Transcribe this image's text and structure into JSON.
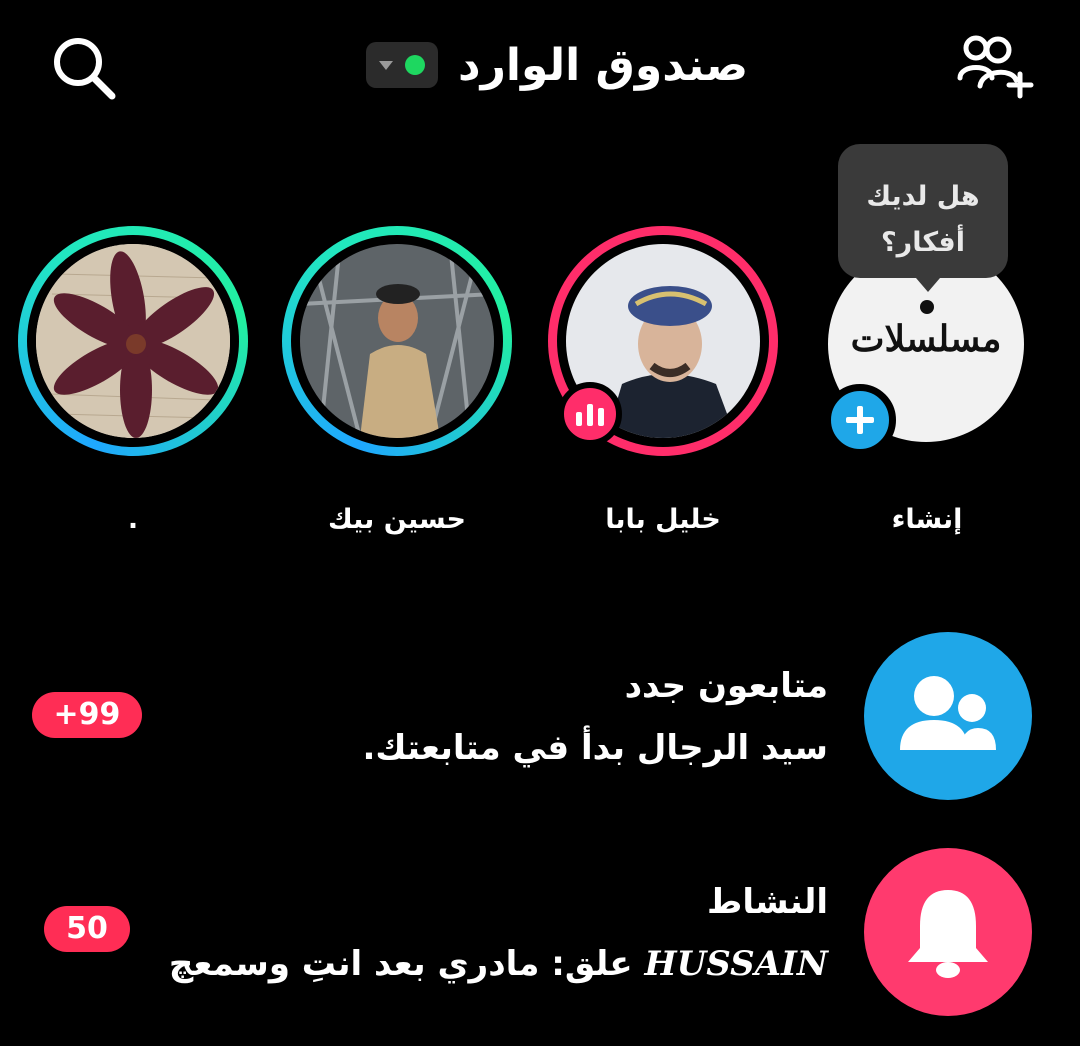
{
  "header": {
    "title": "صندوق الوارد",
    "status_color": "#1ed760",
    "search_icon": "search-icon",
    "add_friends_icon": "add-friends-icon"
  },
  "create_story": {
    "label": "إنشاء",
    "preview_text": "مسلسلات",
    "tooltip_line1": "هل لديك",
    "tooltip_line2": "أفكار؟"
  },
  "stories": [
    {
      "name": "خليل بابا",
      "ring": "pink",
      "live": true
    },
    {
      "name": "حسين بيك",
      "ring": "green",
      "live": false
    },
    {
      "name": ".",
      "ring": "green",
      "live": false
    }
  ],
  "rows": [
    {
      "title": "متابعون جدد",
      "subtitle": "سيد الرجال بدأ في متابعتك.",
      "badge": "+99",
      "icon_color": "#1fa7e8",
      "icon": "followers-icon"
    },
    {
      "title": "النشاط",
      "subtitle_name": "HUSSAIN",
      "subtitle_text": "علق: مادري بعد انتِ وسمعچ",
      "badge": "50",
      "icon_color": "#ff3a6e",
      "icon": "bell-icon"
    }
  ]
}
